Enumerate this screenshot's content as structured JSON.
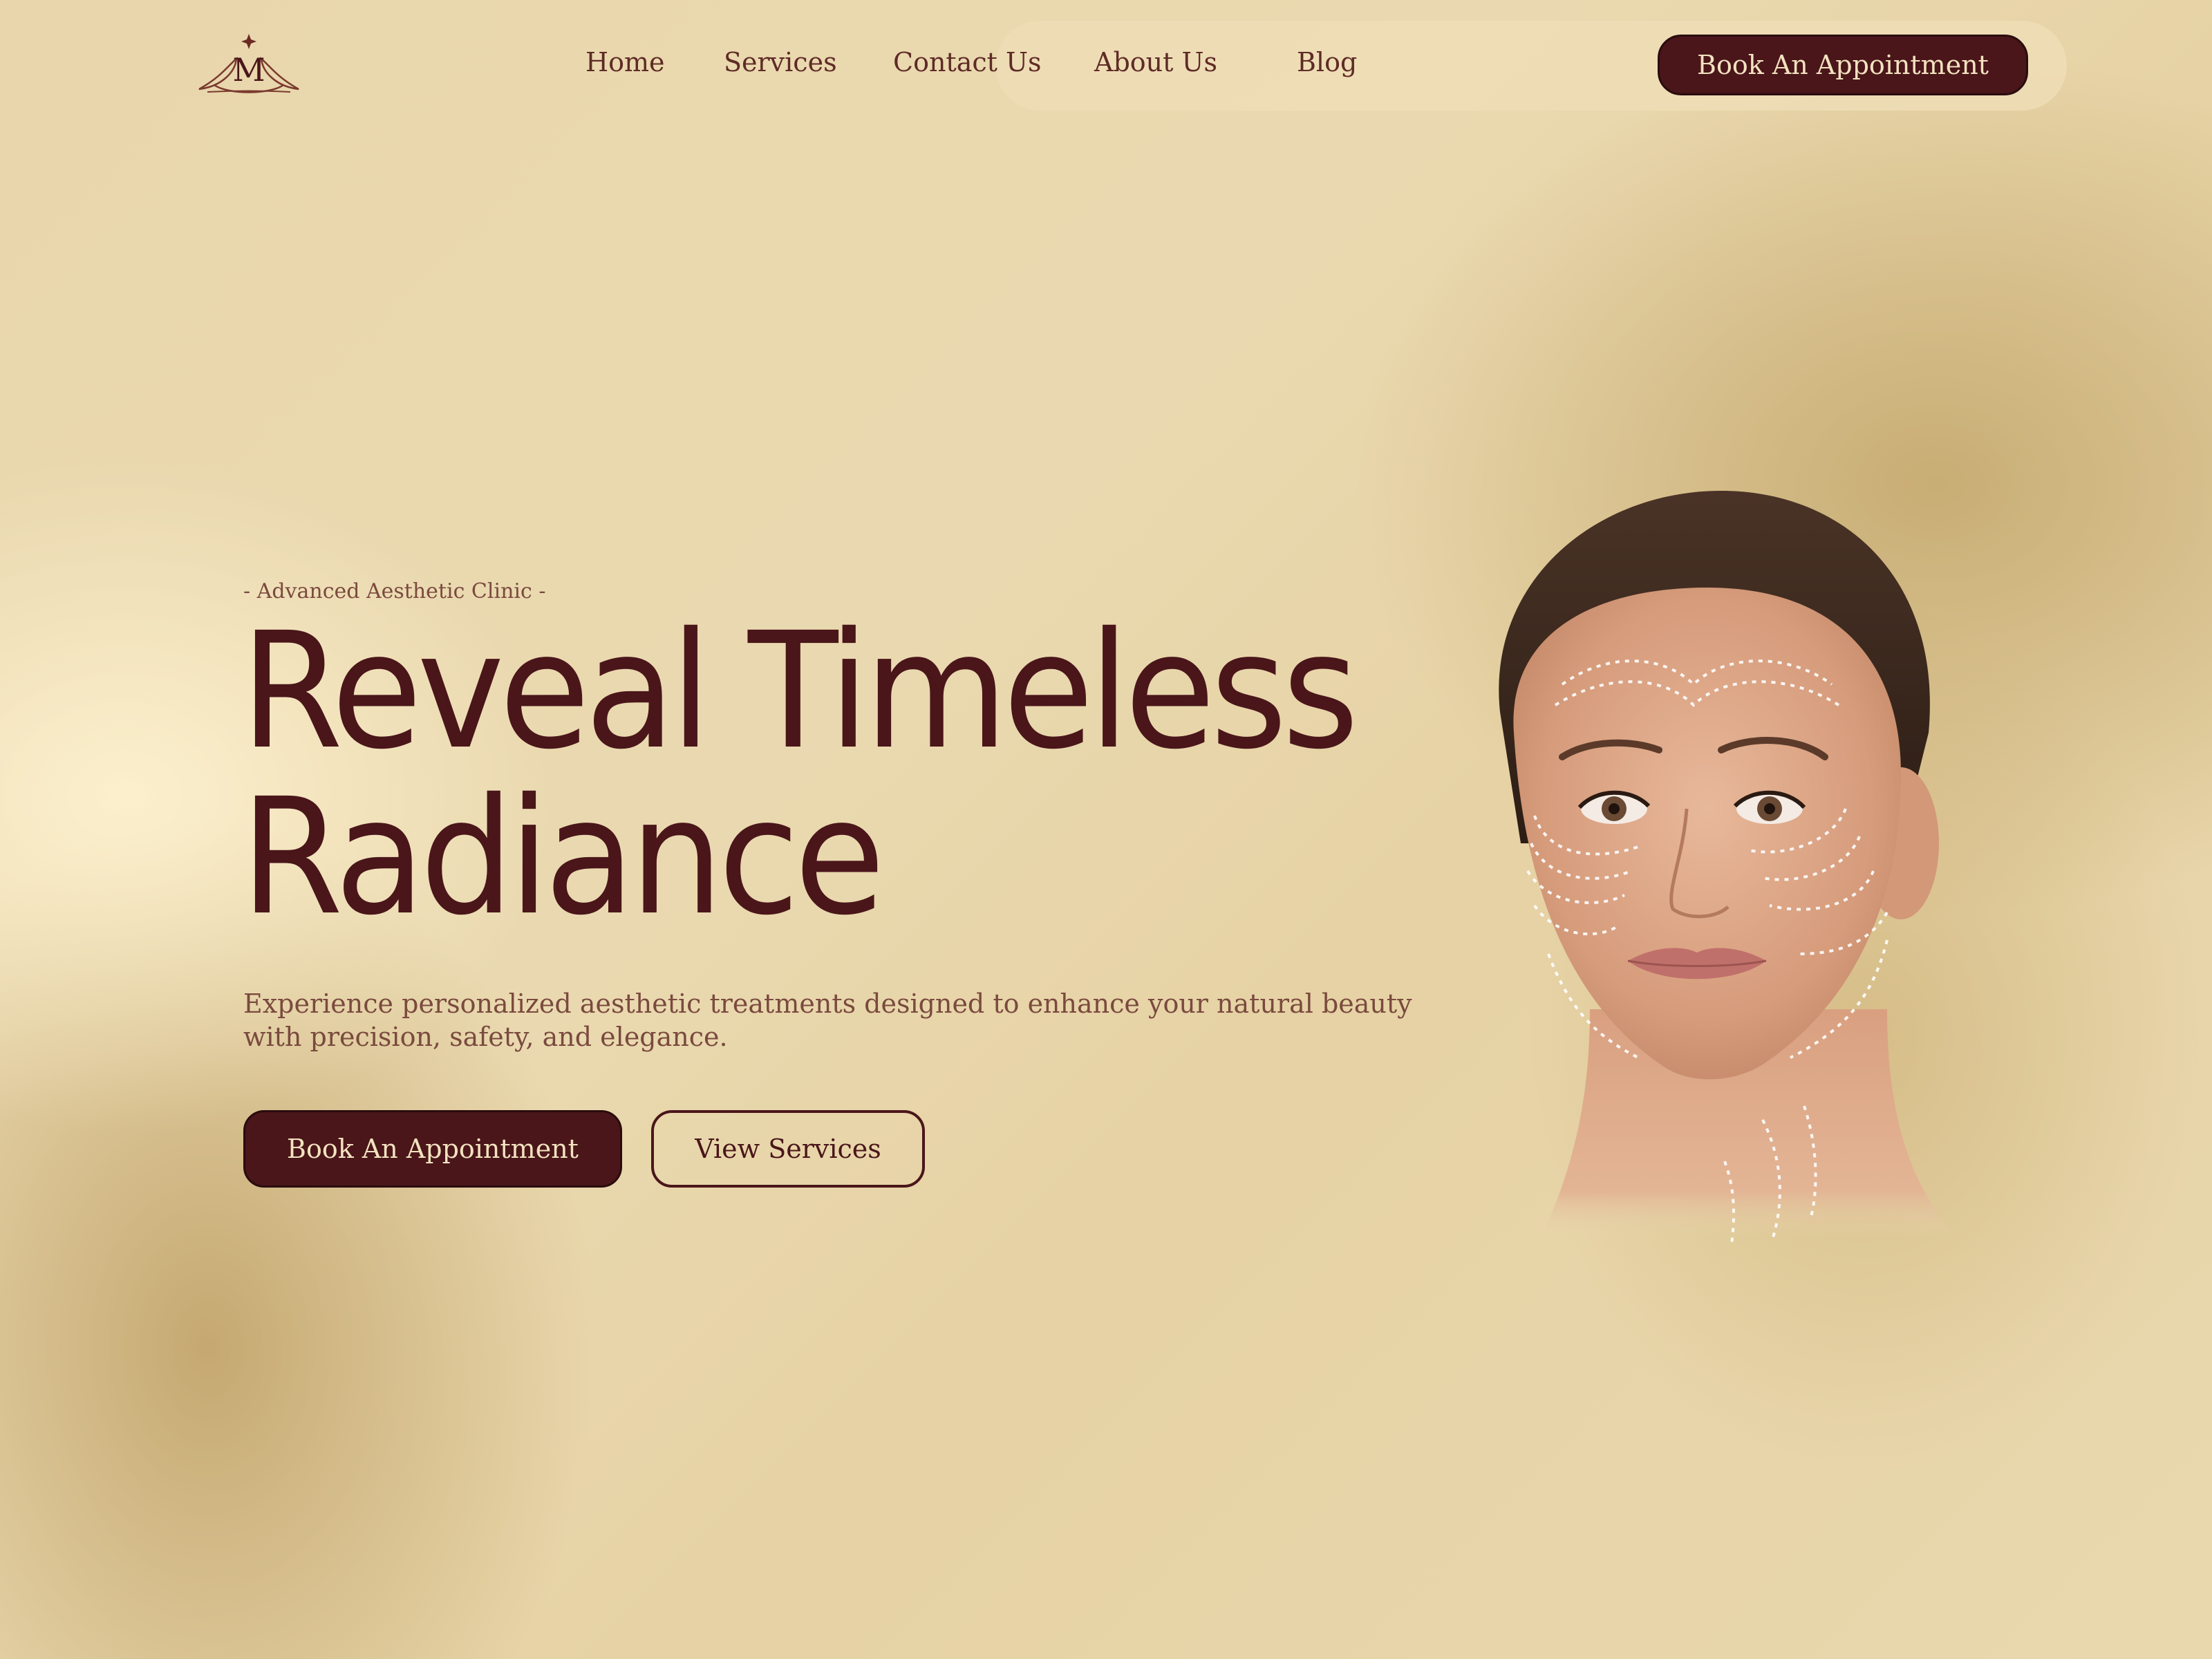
{
  "header": {
    "logo_letter": "M",
    "nav": [
      {
        "label": "Home"
      },
      {
        "label": "Services"
      },
      {
        "label": "Contact Us"
      },
      {
        "label": "About Us"
      },
      {
        "label": "Blog"
      }
    ],
    "cta_label": "Book An Appointment"
  },
  "hero": {
    "eyebrow": "- Advanced Aesthetic Clinic -",
    "headline_line1": "Reveal Timeless",
    "headline_line2": "Radiance",
    "description": "Experience personalized aesthetic treatments designed to enhance your natural beauty with precision, safety, and elegance.",
    "primary_cta": "Book An Appointment",
    "secondary_cta": "View Services"
  },
  "colors": {
    "brand_dark": "#4a161a",
    "background": "#e9d6ac",
    "text_muted": "#7a4a3e"
  },
  "icons": [
    "logo-lotus-m-icon"
  ]
}
